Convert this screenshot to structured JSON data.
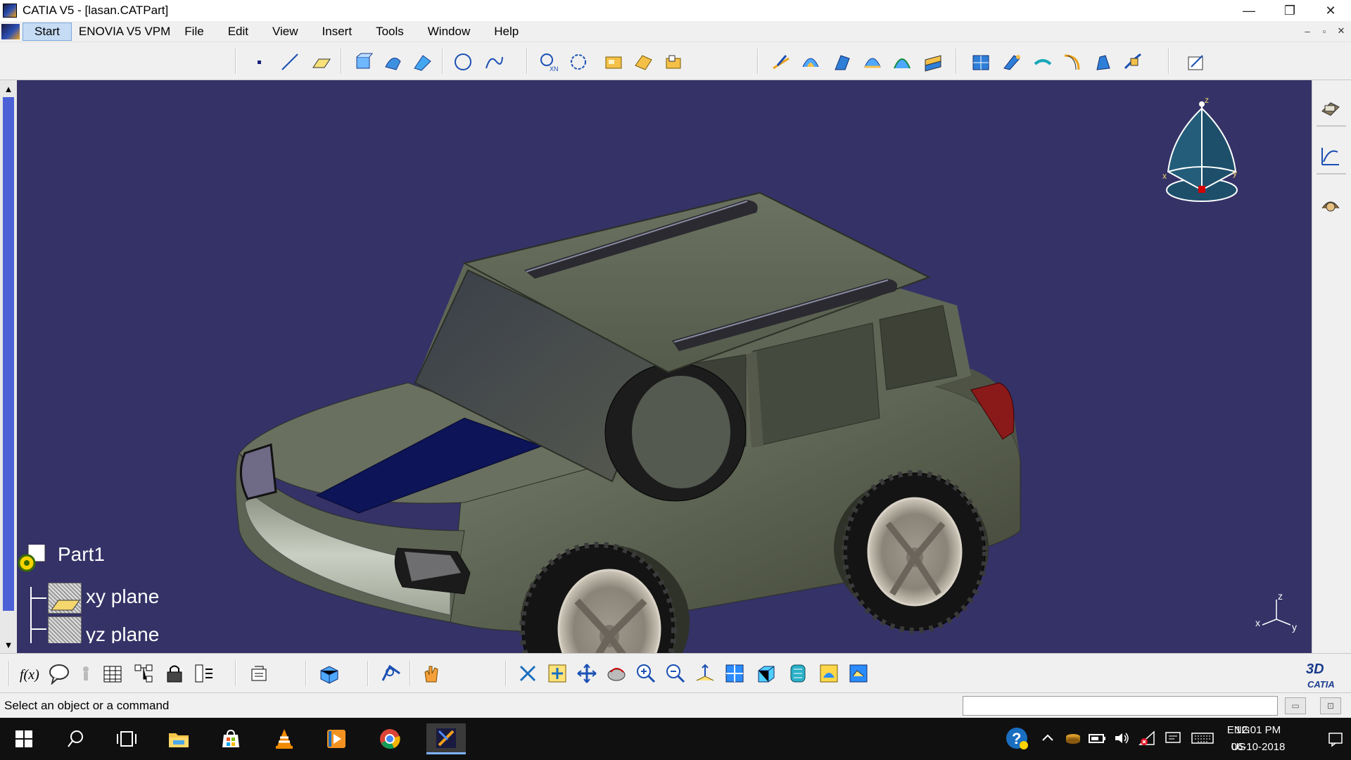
{
  "window": {
    "title": "CATIA V5 - [lasan.CATPart]",
    "controls": {
      "minimize": "—",
      "restore": "❐",
      "close": "✕"
    }
  },
  "menubar": {
    "items": [
      {
        "label": "Start"
      },
      {
        "label": "ENOVIA V5 VPM"
      },
      {
        "label": "File"
      },
      {
        "label": "Edit"
      },
      {
        "label": "View"
      },
      {
        "label": "Insert"
      },
      {
        "label": "Tools"
      },
      {
        "label": "Window"
      },
      {
        "label": "Help"
      }
    ],
    "mdi_controls": {
      "minimize": "–",
      "restore": "▫",
      "close": "✕"
    }
  },
  "toolbar_top": {
    "icons": [
      "point-icon",
      "line-icon",
      "plane-icon",
      "extrude-icon",
      "revolve-icon",
      "sweep-icon",
      "circle-icon",
      "spline-icon",
      "intersection-icon",
      "boundary-icon",
      "join-icon",
      "fill-icon",
      "offset-icon",
      "surface-extrude-icon",
      "surface-revolve-icon",
      "surface-sweep-icon",
      "surface-blend-icon",
      "surface-fill-icon",
      "multi-section-icon",
      "split-icon",
      "trim-icon",
      "extract-icon",
      "fillet-icon",
      "transform-icon",
      "extrapolate-icon",
      "sketch-icon"
    ]
  },
  "toolbar_right": {
    "icons": [
      "workbench-icon",
      "curve-analysis-icon",
      "knowledge-icon"
    ]
  },
  "compass": {
    "x_label": "x",
    "y_label": "y",
    "z_label": "z"
  },
  "triad": {
    "x": "x",
    "y": "y",
    "z": "z"
  },
  "spec_tree": {
    "root": "Part1",
    "children": [
      {
        "label": "xy plane"
      },
      {
        "label": "yz plane"
      }
    ]
  },
  "toolbar_bottom": {
    "icons": [
      "formula-icon",
      "comment-icon",
      "measure-icon",
      "table-icon",
      "hierarchy-icon",
      "lock-icon",
      "parameters-icon",
      "catalog-icon",
      "part-design-icon",
      "analysis-icon",
      "hand-icon",
      "fit-all-icon",
      "pan-icon",
      "rotate-icon",
      "zoom-in-icon",
      "zoom-out-icon",
      "normal-view-icon",
      "iso-view-icon",
      "shading-icon",
      "hide-show-icon",
      "swap-icon",
      "render-icon"
    ]
  },
  "catia_logo": "CATIA",
  "status": {
    "message": "Select an object or a command",
    "command_value": ""
  },
  "taskbar": {
    "apps": [
      "windows-start-icon",
      "search-icon",
      "task-view-icon",
      "file-explorer-icon",
      "store-icon",
      "vlc-icon",
      "media-player-icon",
      "chrome-icon",
      "catia-taskbar-icon"
    ],
    "language": "ENG",
    "region": "US",
    "time": "12:01 PM",
    "date": "06-10-2018"
  },
  "colors": {
    "viewport_bg": "#343266",
    "car_body": "#5b6150",
    "hood_stripe": "#0d1457",
    "accent_blue": "#4d61d6"
  }
}
